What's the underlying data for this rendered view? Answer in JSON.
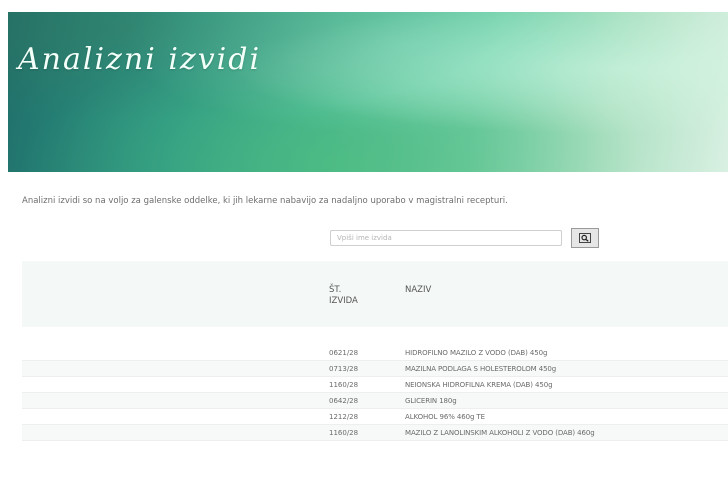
{
  "banner": {
    "title": "Analizni izvidi"
  },
  "intro": "Analizni izvidi so na voljo za galenske oddelke, ki jih lekarne nabavijo za nadaljno uporabo v magistralni recepturi.",
  "search": {
    "placeholder": "Vpiši ime izvida",
    "button_icon": "search-icon"
  },
  "table": {
    "headers": {
      "st": "ŠT. IZVIDA",
      "naziv": "NAZIV"
    },
    "rows": [
      {
        "st": "0621/28",
        "naziv": "HIDROFILNO MAZILO Z VODO (DAB) 450g"
      },
      {
        "st": "0713/28",
        "naziv": "MAZILNA PODLAGA S HOLESTEROLOM 450g"
      },
      {
        "st": "1160/28",
        "naziv": "NEIONSKA HIDROFILNA KREMA (DAB) 450g"
      },
      {
        "st": "0642/28",
        "naziv": "GLICERIN 180g"
      },
      {
        "st": "1212/28",
        "naziv": "ALKOHOL 96% 460g TE"
      },
      {
        "st": "1160/28",
        "naziv": "MAZILO Z LANOLINSKIM ALKOHOLI Z VODO (DAB) 460g"
      }
    ]
  }
}
